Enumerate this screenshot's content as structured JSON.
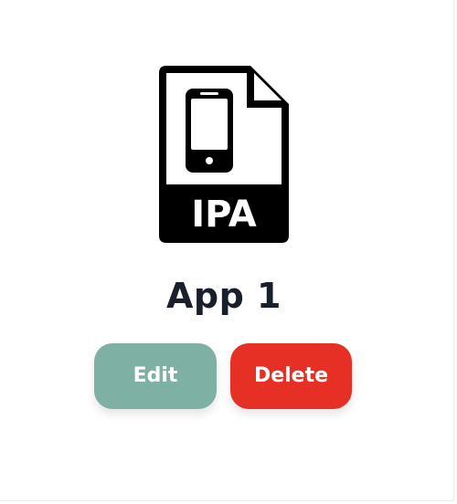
{
  "app": {
    "name": "App 1",
    "file_type_label": "IPA",
    "icon": "ipa-file-icon"
  },
  "actions": {
    "edit_label": "Edit",
    "delete_label": "Delete"
  },
  "colors": {
    "edit_button": "#7fb0a4",
    "delete_button": "#e63026",
    "title_text": "#1a1f2c",
    "icon": "#000000"
  }
}
